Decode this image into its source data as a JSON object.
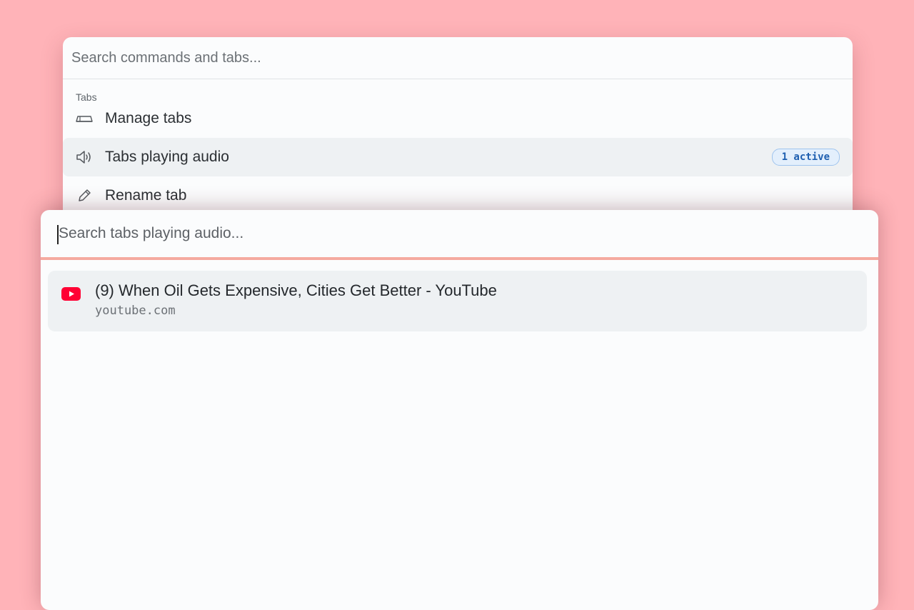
{
  "command_palette": {
    "search_placeholder": "Search commands and tabs...",
    "group_label": "Tabs",
    "items": [
      {
        "label": "Manage tabs",
        "icon": "tabs-icon"
      },
      {
        "label": "Tabs playing audio",
        "icon": "speaker-icon",
        "badge": "1 active",
        "selected": true
      },
      {
        "label": "Rename tab",
        "icon": "pencil-icon"
      }
    ]
  },
  "audio_search": {
    "placeholder": "Search tabs playing audio...",
    "accent_color": "#f5aaa0",
    "results": [
      {
        "title": "(9) When Oil Gets Expensive, Cities Get Better - YouTube",
        "url": "youtube.com",
        "icon": "youtube-icon"
      }
    ]
  },
  "colors": {
    "background": "#ffb3b8",
    "panel": "#fbfcfd",
    "selected_row": "#eef1f3",
    "badge_text": "#1f5fb0",
    "youtube_red": "#ff0033"
  }
}
